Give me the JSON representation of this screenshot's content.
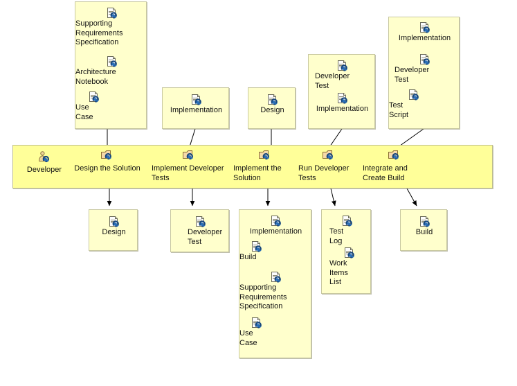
{
  "diagram": {
    "title": "Developer workflow activity diagram",
    "colors": {
      "note_fill": "#ffffcc",
      "band_fill": "#ffff99",
      "note_border": "#c8c8a0",
      "text": "#141414",
      "arrow": "#000000"
    },
    "icons": {
      "artifact": "work-product-document-icon",
      "role": "role-person-icon",
      "task": "task-activity-icon"
    }
  },
  "inputs": [
    {
      "id": "in-design-the-solution",
      "name": "inputs-design-the-solution",
      "artifacts": [
        {
          "label": "Supporting\nRequirements\nSpecification",
          "icon": "work-product-document-icon"
        },
        {
          "label": "Architecture\nNotebook",
          "icon": "work-product-document-icon"
        },
        {
          "label": "Use\nCase",
          "icon": "work-product-document-icon"
        }
      ]
    },
    {
      "id": "in-implement-developer-tests",
      "name": "inputs-implement-developer-tests",
      "artifacts": [
        {
          "label": "Implementation",
          "icon": "work-product-document-icon"
        }
      ]
    },
    {
      "id": "in-implement-the-solution",
      "name": "inputs-implement-the-solution",
      "artifacts": [
        {
          "label": "Design",
          "icon": "work-product-document-icon"
        }
      ]
    },
    {
      "id": "in-run-developer-tests",
      "name": "inputs-run-developer-tests",
      "artifacts": [
        {
          "label": "Developer\nTest",
          "icon": "work-product-document-icon"
        },
        {
          "label": "Implementation",
          "icon": "work-product-document-icon"
        }
      ]
    },
    {
      "id": "in-integrate-and-create-build",
      "name": "inputs-integrate-and-create-build",
      "artifacts": [
        {
          "label": "Implementation",
          "icon": "work-product-document-icon"
        },
        {
          "label": "Developer\nTest",
          "icon": "work-product-document-icon"
        },
        {
          "label": "Test\nScript",
          "icon": "work-product-document-icon"
        }
      ]
    }
  ],
  "band": {
    "role": {
      "label": "Developer",
      "icon": "role-person-icon"
    },
    "tasks": [
      {
        "label": "Design the Solution",
        "icon": "task-activity-icon"
      },
      {
        "label": "Implement Developer\nTests",
        "icon": "task-activity-icon"
      },
      {
        "label": "Implement the\nSolution",
        "icon": "task-activity-icon"
      },
      {
        "label": "Run Developer\nTests",
        "icon": "task-activity-icon"
      },
      {
        "label": "Integrate and\nCreate Build",
        "icon": "task-activity-icon"
      }
    ]
  },
  "outputs": [
    {
      "id": "out-design-the-solution",
      "name": "outputs-design-the-solution",
      "artifacts": [
        {
          "label": "Design",
          "icon": "work-product-document-icon"
        }
      ]
    },
    {
      "id": "out-implement-developer-tests",
      "name": "outputs-implement-developer-tests",
      "artifacts": [
        {
          "label": "Developer\nTest",
          "icon": "work-product-document-icon"
        }
      ]
    },
    {
      "id": "out-implement-the-solution",
      "name": "outputs-implement-the-solution",
      "artifacts": [
        {
          "label": "Implementation",
          "icon": "work-product-document-icon"
        },
        {
          "label": "Build",
          "icon": "work-product-document-icon"
        },
        {
          "label": "Supporting\nRequirements\nSpecification",
          "icon": "work-product-document-icon"
        },
        {
          "label": "Use\nCase",
          "icon": "work-product-document-icon"
        }
      ]
    },
    {
      "id": "out-run-developer-tests",
      "name": "outputs-run-developer-tests",
      "artifacts": [
        {
          "label": "Test\nLog",
          "icon": "work-product-document-icon"
        },
        {
          "label": "Work\nItems\nList",
          "icon": "work-product-document-icon"
        }
      ]
    },
    {
      "id": "out-integrate-and-create-build",
      "name": "outputs-integrate-and-create-build",
      "artifacts": [
        {
          "label": "Build",
          "icon": "work-product-document-icon"
        }
      ]
    }
  ]
}
